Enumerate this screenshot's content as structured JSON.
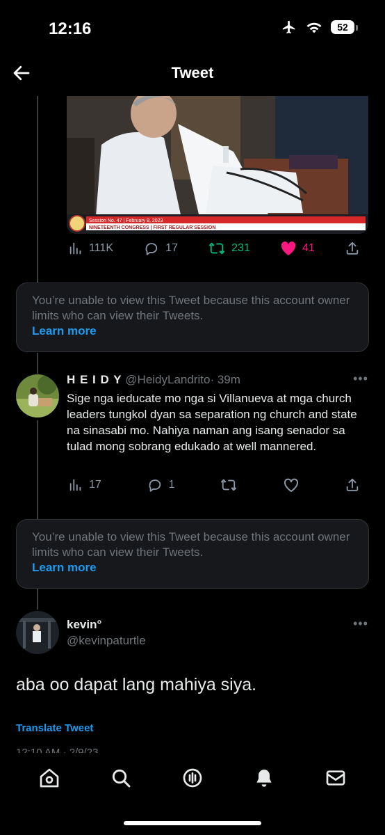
{
  "status_bar": {
    "time": "12:16",
    "battery": "52"
  },
  "header": {
    "title": "Tweet"
  },
  "media": {
    "caption_line1": "Session No. 47 | February 8, 2023",
    "caption_line2": "NINETEENTH CONGRESS | FIRST REGULAR SESSION"
  },
  "top_tweet_actions": {
    "views": "111K",
    "replies": "17",
    "retweets": "231",
    "likes": "41"
  },
  "restricted_1": {
    "message": "You’re unable to view this Tweet because this account owner limits who can view their Tweets.",
    "link": "Learn more"
  },
  "reply": {
    "name": "H E I D Y",
    "handle": "@HeidyLandrito",
    "time": "· 39m",
    "text": "Sige nga ieducate mo nga si Villanueva at mga church leaders tungkol dyan sa separation ng church and state na sinasabi mo. Nahiya naman ang isang senador sa tulad mong sobrang edukado at well mannered.",
    "views": "17",
    "replies": "1"
  },
  "restricted_2": {
    "message": "You’re unable to view this Tweet because this account owner limits who can view their Tweets.",
    "link": "Learn more"
  },
  "main_tweet": {
    "name": "kevin°",
    "handle": "@kevinpaturtle",
    "text": "aba oo dapat lang mahiya siya.",
    "translate": "Translate Tweet",
    "timestamp_partial": "12:10 AM · 2/9/23"
  },
  "colors": {
    "accent": "#1d9bf0",
    "retweet": "#00ba7c",
    "like": "#f91880"
  },
  "icons": [
    "airplane-icon",
    "wifi-icon",
    "battery-icon",
    "back-arrow-icon",
    "views-icon",
    "reply-icon",
    "retweet-icon",
    "like-icon",
    "share-icon",
    "more-icon",
    "home-icon",
    "search-icon",
    "spaces-icon",
    "notifications-icon",
    "messages-icon"
  ]
}
